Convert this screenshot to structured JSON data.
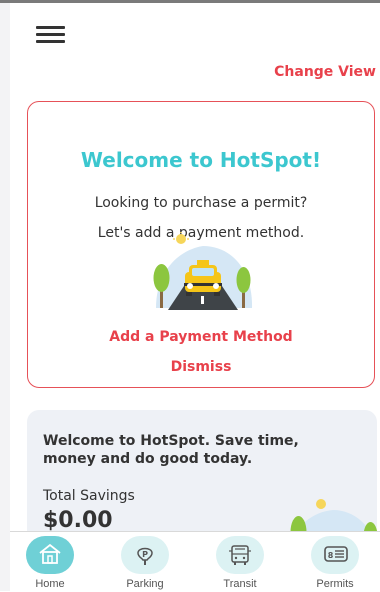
{
  "header": {
    "menu_icon": "hamburger-menu-icon",
    "change_view_label": "Change View"
  },
  "welcome_card": {
    "title": "Welcome to HotSpot!",
    "line1": "Looking to purchase a permit?",
    "line2": "Let's add a payment method.",
    "illustration": "taxi-on-road-illustration",
    "add_payment_label": "Add a Payment Method",
    "dismiss_label": "Dismiss"
  },
  "savings_card": {
    "message": "Welcome to HotSpot. Save time, money and do good today.",
    "total_label": "Total Savings",
    "total_value": "$0.00",
    "illustration": "road-trees-illustration"
  },
  "tabs": [
    {
      "label": "Home",
      "icon": "home-icon",
      "active": true
    },
    {
      "label": "Parking",
      "icon": "parking-meter-icon",
      "active": false
    },
    {
      "label": "Transit",
      "icon": "bus-icon",
      "active": false
    },
    {
      "label": "Permits",
      "icon": "permit-card-icon",
      "active": false
    }
  ],
  "colors": {
    "accent_red": "#e8414b",
    "accent_teal": "#3cc7cf",
    "active_tab": "#6fd0d6",
    "inactive_tab": "#dcf2f3"
  }
}
